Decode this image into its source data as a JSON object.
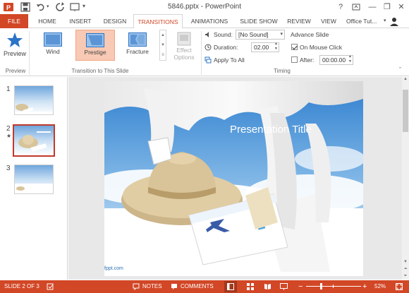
{
  "window": {
    "title": "5846.pptx - PowerPoint",
    "help": "?",
    "minimize": "—",
    "restore": "❐",
    "close": "✕"
  },
  "tabs": [
    "FILE",
    "HOME",
    "INSERT",
    "DESIGN",
    "TRANSITIONS",
    "ANIMATIONS",
    "SLIDE SHOW",
    "REVIEW",
    "VIEW"
  ],
  "account": "Office Tut...",
  "ribbon": {
    "preview_label": "Preview",
    "preview_group": "Preview",
    "transitions": [
      "Wind",
      "Prestige",
      "Fracture"
    ],
    "transitions_group": "Transition to This Slide",
    "effect_options": [
      "Effect",
      "Options"
    ],
    "sound_label": "Sound:",
    "sound_value": "[No Sound]",
    "duration_label": "Duration:",
    "duration_value": "02.00",
    "apply_all": "Apply To All",
    "advance_label": "Advance Slide",
    "on_click_label": "On Mouse Click",
    "after_label": "After:",
    "after_value": "00:00.00",
    "timing_group": "Timing"
  },
  "slides": [
    {
      "num": "1"
    },
    {
      "num": "2",
      "star": "★"
    },
    {
      "num": "3"
    }
  ],
  "slide": {
    "title": "Presentation Title",
    "footer": "fppt.com"
  },
  "status": {
    "slide_info": "SLIDE 2 OF 3",
    "notes": "NOTES",
    "comments": "COMMENTS",
    "zoom": "52%"
  },
  "colors": {
    "accent": "#d24726",
    "selected_transition": "#f8c9b4"
  }
}
